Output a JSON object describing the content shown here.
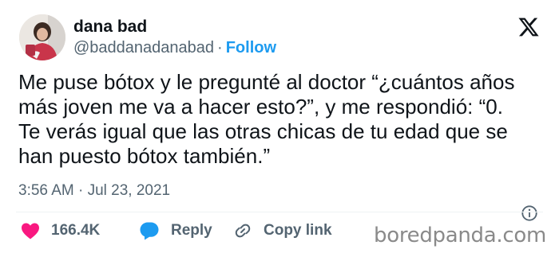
{
  "user": {
    "display_name": "dana bad",
    "handle": "@baddanadanabad",
    "separator": "·",
    "follow_label": "Follow"
  },
  "tweet": {
    "lines": [
      "Me puse bótox y le pregunté al doctor “¿cuántos años",
      "más joven me va a hacer esto?”, y me respondió: “0.",
      "Te verás igual que las otras chicas de tu edad que se",
      "han puesto bótox también.”"
    ],
    "timestamp": "3:56 AM · Jul 23, 2021"
  },
  "actions": {
    "likes_count": "166.4K",
    "reply_label": "Reply",
    "copy_link_label": "Copy link"
  },
  "watermark": "boredpanda.com",
  "colors": {
    "text": "#0f1419",
    "secondary": "#536471",
    "follow_blue": "#1d9bf0",
    "like_red": "#f91880",
    "reply_blue": "#1d9bf0"
  },
  "icons": [
    "x-logo-icon",
    "info-icon",
    "heart-icon",
    "reply-bubble-icon",
    "link-icon"
  ]
}
